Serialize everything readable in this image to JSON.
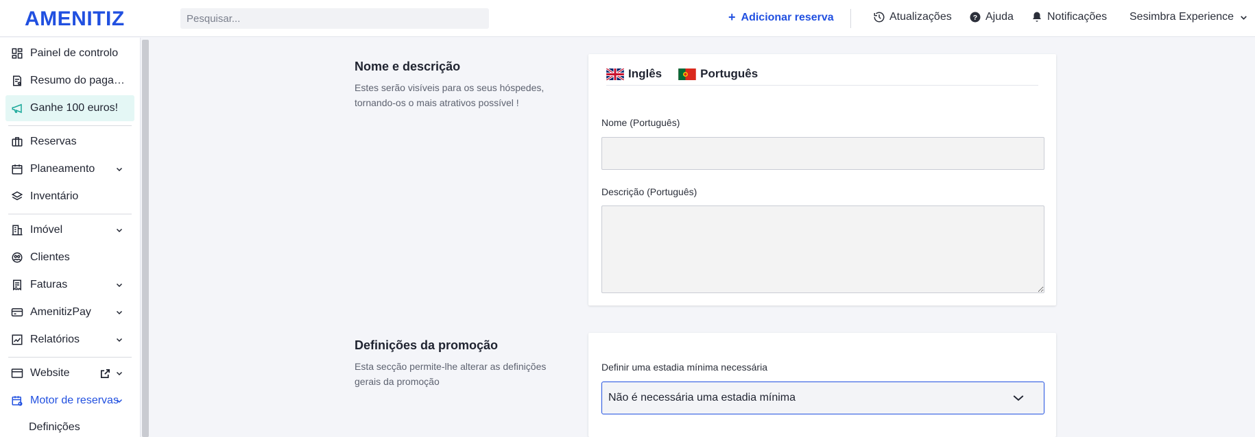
{
  "brand": {
    "logo_text": "AMENITIZ",
    "accent_color": "#2150e0"
  },
  "header": {
    "search_placeholder": "Pesquisar...",
    "add_reservation_label": "Adicionar reserva",
    "updates_label": "Atualizações",
    "help_label": "Ajuda",
    "notifications_label": "Notificações",
    "property_label": "Sesimbra Experience"
  },
  "sidebar": {
    "items": [
      {
        "label": "Painel de controlo",
        "icon": "dashboard-icon"
      },
      {
        "label": "Resumo do pagamento",
        "icon": "payment-summary-icon"
      },
      {
        "label": "Ganhe 100 euros!",
        "icon": "megaphone-icon"
      },
      {
        "label": "Reservas",
        "icon": "briefcase-icon"
      },
      {
        "label": "Planeamento",
        "icon": "calendar-icon"
      },
      {
        "label": "Inventário",
        "icon": "layers-icon"
      },
      {
        "label": "Imóvel",
        "icon": "building-icon"
      },
      {
        "label": "Clientes",
        "icon": "users-icon"
      },
      {
        "label": "Faturas",
        "icon": "invoice-icon"
      },
      {
        "label": "AmenitizPay",
        "icon": "card-icon"
      },
      {
        "label": "Relatórios",
        "icon": "chart-icon"
      },
      {
        "label": "Website",
        "icon": "browser-icon"
      },
      {
        "label": "Motor de reservas",
        "icon": "booking-engine-icon"
      }
    ],
    "sub_item": "Definições"
  },
  "main": {
    "name_section": {
      "title": "Nome e descrição",
      "description": "Estes serão visíveis para os seus hóspedes, tornando-os o mais atrativos possível !",
      "tabs": [
        {
          "label": "Inglês"
        },
        {
          "label": "Português"
        }
      ],
      "name_label": "Nome (Português)",
      "name_value": "",
      "description_label": "Descrição (Português)",
      "description_value": ""
    },
    "promo_section": {
      "title": "Definições da promoção",
      "description": "Esta secção permite-lhe alterar as definições gerais da promoção",
      "min_stay_label": "Definir uma estadia mínima necessária",
      "min_stay_value": "Não é necessária uma estadia mínima"
    }
  }
}
